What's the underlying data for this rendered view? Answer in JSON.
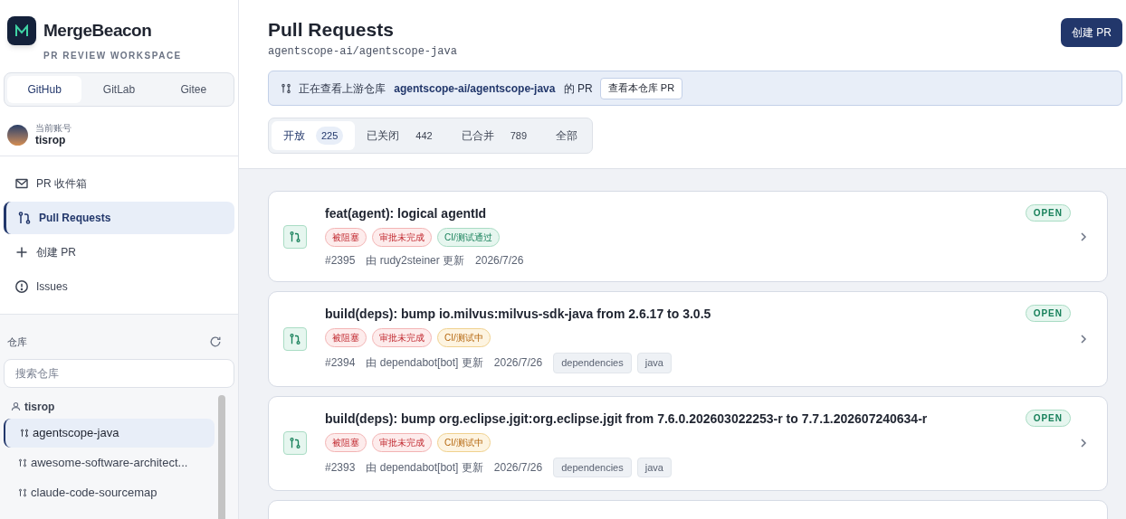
{
  "app": {
    "name": "MergeBeacon",
    "subtitle": "PR REVIEW WORKSPACE"
  },
  "providers": [
    {
      "label": "GitHub",
      "selected": true
    },
    {
      "label": "GitLab",
      "selected": false
    },
    {
      "label": "Gitee",
      "selected": false
    }
  ],
  "account": {
    "caption": "当前账号",
    "name": "tisrop"
  },
  "nav": [
    {
      "label": "PR 收件箱",
      "kind": "inbox",
      "selected": false
    },
    {
      "label": "Pull Requests",
      "kind": "pulls",
      "selected": true
    },
    {
      "label": "创建 PR",
      "kind": "create",
      "selected": false
    },
    {
      "label": "Issues",
      "kind": "issues",
      "selected": false
    }
  ],
  "repos": {
    "title": "仓库",
    "search_placeholder": "搜索仓库",
    "groups": [
      {
        "owner": "tisrop",
        "children": [
          {
            "name": "agentscope-java",
            "selected": true
          },
          {
            "name": "awesome-software-architect...",
            "selected": false
          },
          {
            "name": "claude-code-sourcemap",
            "selected": false
          }
        ]
      }
    ]
  },
  "page": {
    "title": "Pull Requests",
    "repo": "agentscope-ai/agentscope-java",
    "create_button": "创建 PR"
  },
  "banner": {
    "text": "正在查看上游仓库 **agentscope-ai/agentscope-java** 的 PR",
    "button": "查看本仓库 PR"
  },
  "tabs": [
    {
      "label": "开放",
      "count": "225",
      "selected": true
    },
    {
      "label": "已关闭",
      "count": "442",
      "selected": false
    },
    {
      "label": "已合并",
      "count": "789",
      "selected": false
    },
    {
      "label": "全部",
      "selected": false
    }
  ],
  "pull_requests": [
    {
      "title": "feat(agent): logical agentId",
      "status": "OPEN",
      "badges": [
        {
          "label": "被阻塞",
          "kind": "danger"
        },
        {
          "label": "审批未完成",
          "kind": "danger"
        },
        {
          "label": "CI/测试通过",
          "kind": "success"
        }
      ],
      "number": "#2395",
      "author": "由 rudy2steiner 更新",
      "date": "2026/7/26"
    },
    {
      "title": "build(deps): bump io.milvus:milvus-sdk-java from 2.6.17 to 3.0.5",
      "status": "OPEN",
      "badges": [
        {
          "label": "被阻塞",
          "kind": "danger"
        },
        {
          "label": "审批未完成",
          "kind": "danger"
        },
        {
          "label": "CI/测试中",
          "kind": "warning"
        }
      ],
      "number": "#2394",
      "author": "由 dependabot[bot] 更新",
      "date": "2026/7/26",
      "labels": [
        "dependencies",
        "java"
      ]
    },
    {
      "title": "build(deps): bump org.eclipse.jgit:org.eclipse.jgit from 7.6.0.202603022253-r to 7.7.1.202607240634-r",
      "status": "OPEN",
      "badges": [
        {
          "label": "被阻塞",
          "kind": "danger"
        },
        {
          "label": "审批未完成",
          "kind": "danger"
        },
        {
          "label": "CI/测试中",
          "kind": "warning"
        }
      ],
      "number": "#2393",
      "author": "由 dependabot[bot] 更新",
      "date": "2026/7/26",
      "labels": [
        "dependencies",
        "java"
      ]
    }
  ]
}
